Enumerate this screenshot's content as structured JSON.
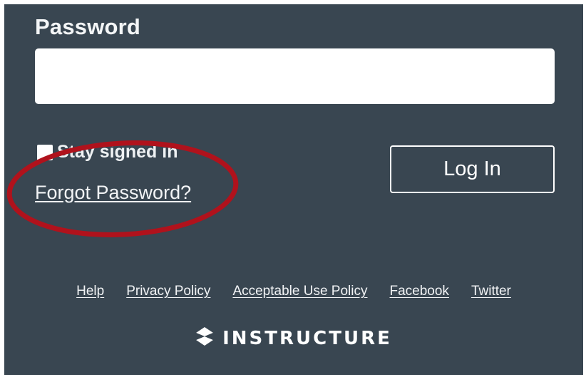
{
  "form": {
    "password_label": "Password",
    "password_value": "",
    "stay_signed_in_label": "Stay signed in",
    "forgot_password_label": "Forgot Password?",
    "login_button_label": "Log In"
  },
  "footer": {
    "links": [
      "Help",
      "Privacy Policy",
      "Acceptable Use Policy",
      "Facebook",
      "Twitter"
    ]
  },
  "brand": {
    "name": "INSTRUCTURE",
    "icon": "instructure-logo-icon"
  },
  "annotation": {
    "color": "#b0121c"
  },
  "colors": {
    "background": "#394651",
    "text": "#ffffff"
  }
}
